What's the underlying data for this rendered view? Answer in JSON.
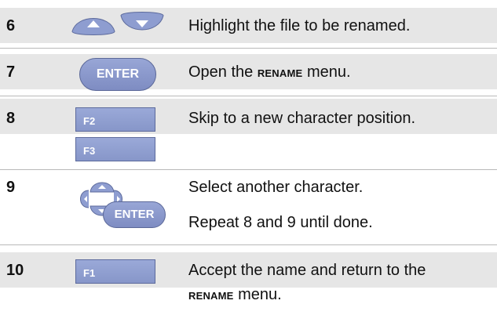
{
  "steps": [
    {
      "number": "6",
      "description": "Highlight the file to be renamed."
    },
    {
      "number": "7",
      "key": "ENTER",
      "description_pre": "Open the ",
      "description_menu": "RENAME",
      "description_post": " menu."
    },
    {
      "number": "8",
      "keys": [
        "F2",
        "F3"
      ],
      "description": "Skip to a new character position."
    },
    {
      "number": "9",
      "key": "ENTER",
      "description": "Select another character.",
      "description2": "Repeat 8 and 9 until done."
    },
    {
      "number": "10",
      "key": "F1",
      "description_line1": "Accept the name and return to the",
      "description_menu": "RENAME",
      "description_post": " menu."
    }
  ],
  "icons": [
    "arrow-up-icon",
    "arrow-down-icon",
    "arrow-pad-icon"
  ],
  "colors": {
    "band": "#e6e6e6",
    "key_fill": "#8e9dd0",
    "key_border": "#5c6a9c"
  }
}
